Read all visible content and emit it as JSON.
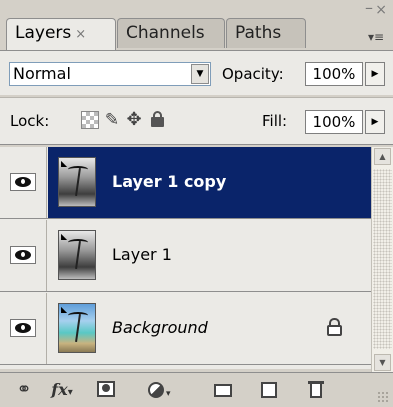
{
  "window": {
    "minimize_glyph": "–",
    "close_glyph": "×"
  },
  "tabs": [
    {
      "label": "Layers",
      "close": "×",
      "active": true
    },
    {
      "label": "Channels",
      "active": false
    },
    {
      "label": "Paths",
      "active": false
    }
  ],
  "panel_menu_glyph": "▾≡",
  "options": {
    "blend_mode": "Normal",
    "opacity_label": "Opacity:",
    "opacity_value": "100%",
    "lock_label": "Lock:",
    "fill_label": "Fill:",
    "fill_value": "100%"
  },
  "layers": [
    {
      "name": "Layer 1 copy",
      "visible": true,
      "selected": true,
      "locked": false,
      "thumbnail": "grayscale-palm"
    },
    {
      "name": "Layer 1",
      "visible": true,
      "selected": false,
      "locked": false,
      "thumbnail": "grayscale-palm"
    },
    {
      "name": "Background",
      "visible": true,
      "selected": false,
      "locked": true,
      "thumbnail": "color-palm-beach"
    }
  ],
  "footer": {
    "fx_label": "fx",
    "buttons": [
      "link-layers",
      "layer-style",
      "layer-mask",
      "adjustment-layer",
      "new-group",
      "new-layer",
      "delete-layer"
    ]
  },
  "colors": {
    "panel_bg": "#d4d0c8",
    "row_bg": "#ebeae6",
    "selection": "#0a246a"
  }
}
